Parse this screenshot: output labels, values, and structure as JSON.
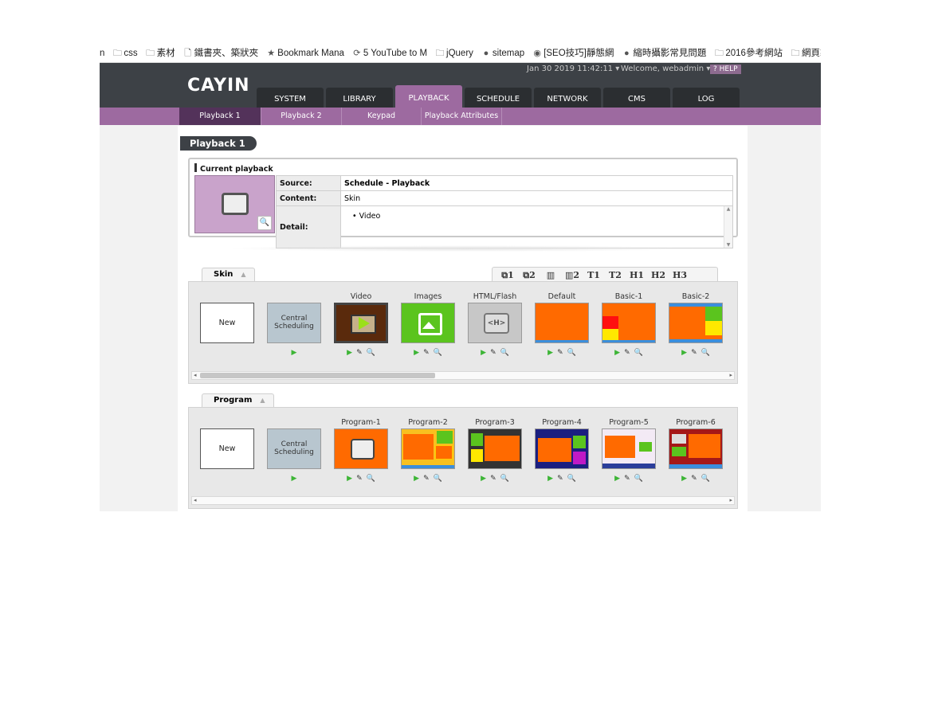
{
  "bookmarks": [
    {
      "icon": "",
      "label": "n"
    },
    {
      "icon": "folder-icon",
      "label": "css"
    },
    {
      "icon": "folder-icon",
      "label": "素材"
    },
    {
      "icon": "page-icon",
      "label": "鐵書夾、築狀夾"
    },
    {
      "icon": "star-icon",
      "label": "Bookmark Mana"
    },
    {
      "icon": "sync-icon",
      "label": "5 YouTube to M"
    },
    {
      "icon": "folder-icon",
      "label": "jQuery"
    },
    {
      "icon": "globe-icon",
      "label": "sitemap"
    },
    {
      "icon": "seo-icon",
      "label": "[SEO技巧]靜態網"
    },
    {
      "icon": "github-icon",
      "label": "縮時攝影常見問題"
    },
    {
      "icon": "folder-icon",
      "label": "2016參考網站"
    },
    {
      "icon": "folder-icon",
      "label": "網頁製作"
    }
  ],
  "header": {
    "logo": "CAYIN",
    "datetime": "Jan 30 2019 11:42:11",
    "welcome": "Welcome, webadmin",
    "help": "HELP"
  },
  "tabs": [
    "SYSTEM",
    "LIBRARY",
    "PLAYBACK",
    "SCHEDULE",
    "NETWORK",
    "CMS",
    "LOG"
  ],
  "active_tab": "PLAYBACK",
  "subnav": [
    "Playback 1",
    "Playback 2",
    "Keypad",
    "Playback Attributes"
  ],
  "page_title": "Playback 1",
  "current": {
    "label": "Current playback",
    "source_key": "Source:",
    "source_val": "Schedule - Playback",
    "content_key": "Content:",
    "content_val": "Skin",
    "detail_key": "Detail:",
    "detail_item": "Video"
  },
  "skin_panel": {
    "tab": "Skin",
    "tools": [
      "⧉1",
      "⧉2",
      "▥",
      "▥2",
      "T1",
      "T2",
      "H1",
      "H2",
      "H3"
    ],
    "cards": [
      {
        "label": "",
        "text": "New",
        "type": "new"
      },
      {
        "label": "",
        "text": "Central Scheduling",
        "type": "cs"
      },
      {
        "label": "Video",
        "type": "video"
      },
      {
        "label": "Images",
        "type": "images"
      },
      {
        "label": "HTML/Flash",
        "type": "html"
      },
      {
        "label": "Default",
        "type": "default"
      },
      {
        "label": "Basic-1",
        "type": "basic1"
      },
      {
        "label": "Basic-2",
        "type": "basic2"
      }
    ]
  },
  "program_panel": {
    "tab": "Program",
    "cards": [
      {
        "label": "",
        "text": "New",
        "type": "new"
      },
      {
        "label": "",
        "text": "Central Scheduling",
        "type": "cs"
      },
      {
        "label": "Program-1",
        "type": "p1"
      },
      {
        "label": "Program-2",
        "type": "p2"
      },
      {
        "label": "Program-3",
        "type": "p3"
      },
      {
        "label": "Program-4",
        "type": "p4"
      },
      {
        "label": "Program-5",
        "type": "p5"
      },
      {
        "label": "Program-6",
        "type": "p6"
      }
    ]
  },
  "colors": {
    "header_bg": "#3d4146",
    "accent_purple": "#9d6aa0",
    "orange": "#ff6a00",
    "play_green": "#3db536"
  }
}
